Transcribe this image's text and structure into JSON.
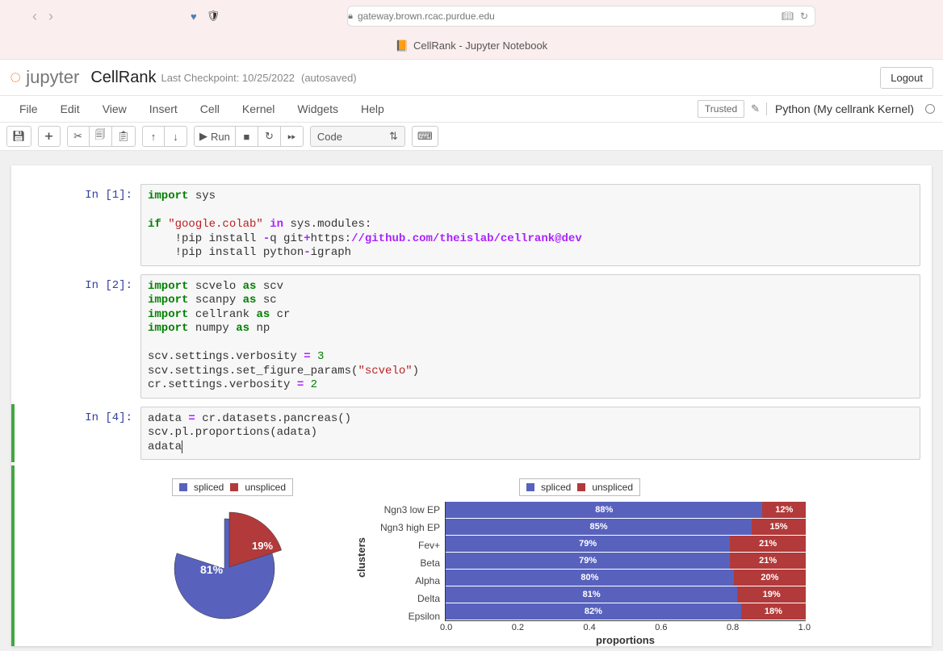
{
  "browser": {
    "url": "gateway.brown.rcac.purdue.edu",
    "tab_title": "CellRank - Jupyter Notebook"
  },
  "jupyter": {
    "logo_text": "jupyter",
    "notebook_name": "CellRank",
    "checkpoint": "Last Checkpoint: 10/25/2022",
    "autosaved": "(autosaved)",
    "logout": "Logout",
    "trusted": "Trusted",
    "kernel_name": "Python (My cellrank Kernel)",
    "menus": [
      "File",
      "Edit",
      "View",
      "Insert",
      "Cell",
      "Kernel",
      "Widgets",
      "Help"
    ],
    "run_label": "Run",
    "cell_type": "Code"
  },
  "cells": {
    "c1": {
      "prompt": "In [1]:",
      "kw_import": "import",
      "sys": " sys",
      "kw_if": "if",
      "str_colab": " \"google.colab\"",
      "kw_in": " in",
      "mods": " sys.modules:",
      "pip1a": "    !pip install ",
      "pip1b": "-",
      "pip1c": "q git",
      "pip1d": "+",
      "pip1e": "https:",
      "pip1f": "//github.com/theislab/cellrank@dev",
      "pip2a": "    !pip install python",
      "pip2b": "-",
      "pip2c": "igraph"
    },
    "c2": {
      "prompt": "In [2]:",
      "kw_import": "import",
      "kw_as": "as",
      "l1a": " scvelo ",
      "l1b": " scv",
      "l2a": " scanpy ",
      "l2b": " sc",
      "l3a": " cellrank ",
      "l3b": " cr",
      "l4a": " numpy ",
      "l4b": " np",
      "l6": "scv.settings.verbosity ",
      "eq": "=",
      "l6n": " 3",
      "l7a": "scv.settings.set_figure_params(",
      "l7s": "\"scvelo\"",
      "l7b": ")",
      "l8": "cr.settings.verbosity ",
      "l8n": " 2"
    },
    "c4": {
      "prompt": "In [4]:",
      "l1": "adata ",
      "eq": "=",
      "l1b": " cr.datasets.pancreas()",
      "l2": "scv.pl.proportions(adata)",
      "l3": "adata"
    }
  },
  "chart_data": [
    {
      "type": "pie",
      "legend": [
        "spliced",
        "unspliced"
      ],
      "colors": {
        "spliced": "#5862bd",
        "unspliced": "#b23a3a"
      },
      "values": {
        "spliced": 81,
        "unspliced": 19
      },
      "labels": {
        "spliced": "81%",
        "unspliced": "19%"
      }
    },
    {
      "type": "bar",
      "orientation": "horizontal-stacked",
      "legend": [
        "spliced",
        "unspliced"
      ],
      "colors": {
        "spliced": "#5862bd",
        "unspliced": "#b23a3a"
      },
      "ylabel": "clusters",
      "xlabel": "proportions",
      "xlim": [
        0.0,
        1.0
      ],
      "xticks": [
        "0.0",
        "0.2",
        "0.4",
        "0.6",
        "0.8",
        "1.0"
      ],
      "categories": [
        "Ngn3 low EP",
        "Ngn3 high EP",
        "Fev+",
        "Beta",
        "Alpha",
        "Delta",
        "Epsilon"
      ],
      "series": [
        {
          "name": "spliced",
          "values": [
            88,
            85,
            79,
            79,
            80,
            81,
            82
          ],
          "labels": [
            "88%",
            "85%",
            "79%",
            "79%",
            "80%",
            "81%",
            "82%"
          ]
        },
        {
          "name": "unspliced",
          "values": [
            12,
            15,
            21,
            21,
            20,
            19,
            18
          ],
          "labels": [
            "12%",
            "15%",
            "21%",
            "21%",
            "20%",
            "19%",
            "18%"
          ]
        }
      ]
    }
  ]
}
